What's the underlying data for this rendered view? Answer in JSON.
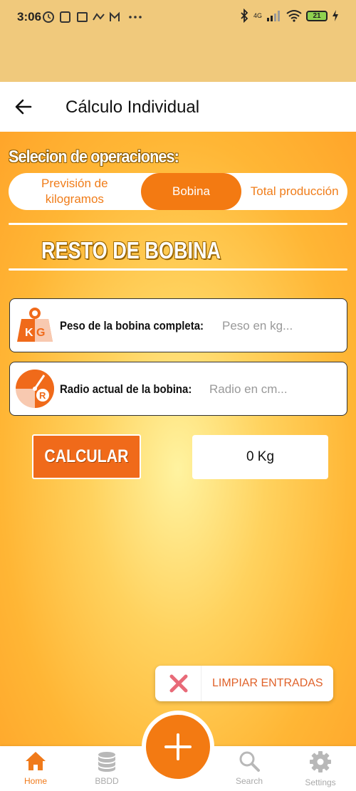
{
  "status_bar": {
    "time": "3:06",
    "notification_icons": [
      "alarm-icon",
      "nfc-icon",
      "message-icon",
      "missed-call-icon",
      "gmail-icon",
      "more-icon"
    ],
    "network": "4G",
    "battery": "21"
  },
  "appbar": {
    "title": "Cálculo Individual"
  },
  "operations": {
    "title": "Selecion de operaciones:",
    "tabs": [
      {
        "label": "Previsión de kilogramos"
      },
      {
        "label": "Bobina"
      },
      {
        "label": "Total producción"
      }
    ],
    "selected": "Bobina"
  },
  "section": {
    "title": "RESTO DE BOBINA"
  },
  "fields": [
    {
      "icon": "kg-weight-icon",
      "label": "Peso de la bobina completa:",
      "placeholder": "Peso en kg...",
      "value": ""
    },
    {
      "icon": "radius-icon",
      "label": "Radio actual de la bobina:",
      "placeholder": "Radio en cm...",
      "value": ""
    }
  ],
  "calculate": {
    "label": "CALCULAR",
    "result": "0 Kg"
  },
  "snackbar": {
    "icon": "close-x-icon",
    "label": "LIMPIAR ENTRADAS"
  },
  "bottom_nav": {
    "items": [
      {
        "label": "Home",
        "icon": "home-icon",
        "active": true
      },
      {
        "label": "BBDD",
        "icon": "database-icon",
        "active": false
      },
      {
        "label": "Search",
        "icon": "search-icon",
        "active": false
      },
      {
        "label": "Settings",
        "icon": "gear-icon",
        "active": false
      }
    ],
    "fab_icon": "plus-icon"
  },
  "colors": {
    "accent": "#f37a12",
    "status_bar_bg": "#f0c97c",
    "gradient_center": "#fff3a0",
    "gradient_edge": "#ffa52a"
  }
}
